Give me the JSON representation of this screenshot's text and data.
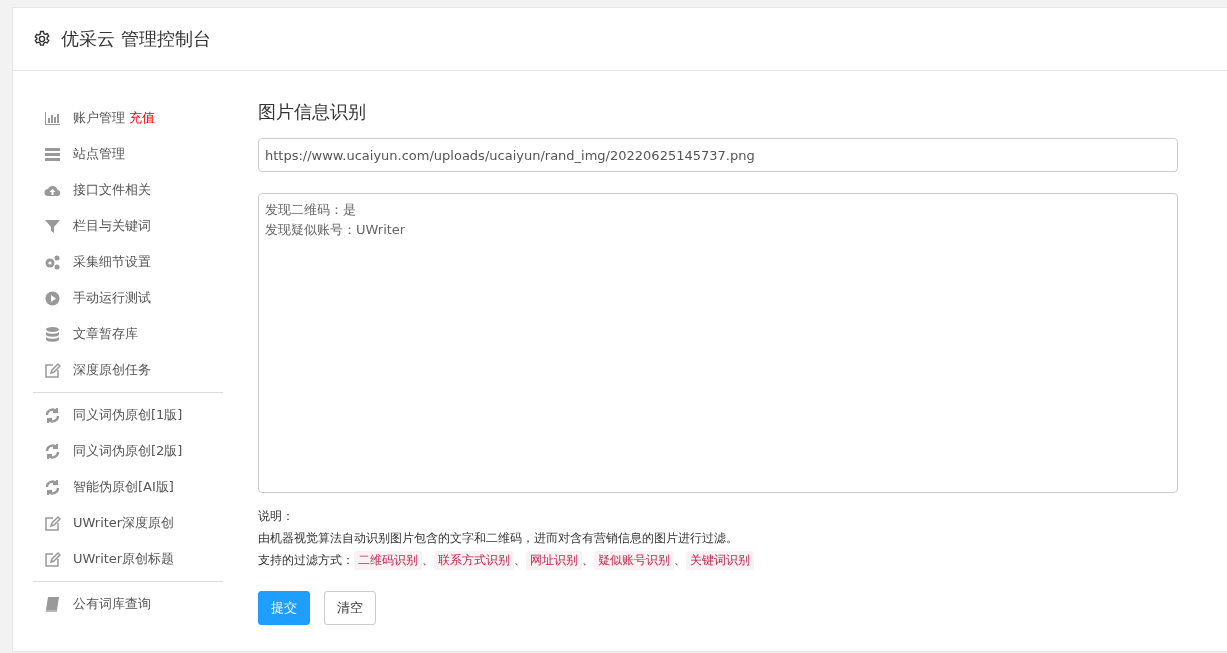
{
  "header": {
    "title": "优采云 管理控制台"
  },
  "sidebar": {
    "groups": [
      [
        {
          "label": "账户管理",
          "extra": "充值"
        },
        {
          "label": "站点管理"
        },
        {
          "label": "接口文件相关"
        },
        {
          "label": "栏目与关键词"
        },
        {
          "label": "采集细节设置"
        },
        {
          "label": "手动运行测试"
        },
        {
          "label": "文章暂存库"
        },
        {
          "label": "深度原创任务"
        }
      ],
      [
        {
          "label": "同义词伪原创[1版]"
        },
        {
          "label": "同义词伪原创[2版]"
        },
        {
          "label": "智能伪原创[AI版]"
        },
        {
          "label": "UWriter深度原创"
        },
        {
          "label": "UWriter原创标题"
        }
      ],
      [
        {
          "label": "公有词库查询"
        }
      ]
    ]
  },
  "main": {
    "title": "图片信息识别",
    "url_field": {
      "value": "https://www.ucaiyun.com/uploads/ucaiyun/rand_img/20220625145737.png"
    },
    "result_box": {
      "lines": [
        "发现二维码：是",
        "发现疑似账号：UWriter"
      ]
    },
    "note_label": "说明：",
    "note_text": "由机器视觉算法自动识别图片包含的文字和二维码，进而对含有营销信息的图片进行过滤。",
    "filters_label": "支持的过滤方式：",
    "separator": "、",
    "filters": [
      "二维码识别",
      "联系方式识别",
      "网址识别",
      "疑似账号识别",
      "关键词识别"
    ],
    "buttons": [
      {
        "label": "提交",
        "kind": "primary"
      },
      {
        "label": "清空",
        "kind": "default"
      }
    ]
  }
}
